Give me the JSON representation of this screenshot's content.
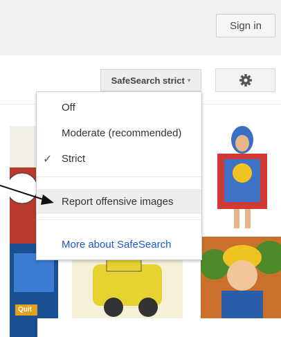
{
  "header": {
    "sign_in_label": "Sign in"
  },
  "toolbar": {
    "safesearch_label": "SafeSearch strict",
    "caret": "▾",
    "settings_icon": "gear-icon"
  },
  "safesearch_menu": {
    "items": [
      {
        "label": "Off",
        "checked": false
      },
      {
        "label": "Moderate (recommended)",
        "checked": false
      },
      {
        "label": "Strict",
        "checked": true
      }
    ],
    "check_glyph": "✓",
    "report_label": "Report offensive images",
    "more_label": "More about SafeSearch"
  },
  "thumbnail_text": {
    "quit_label": "Quit"
  },
  "colors": {
    "link": "#1a58c9",
    "button_bg": "#eeeeee",
    "header_bg": "#f1f1f1"
  }
}
